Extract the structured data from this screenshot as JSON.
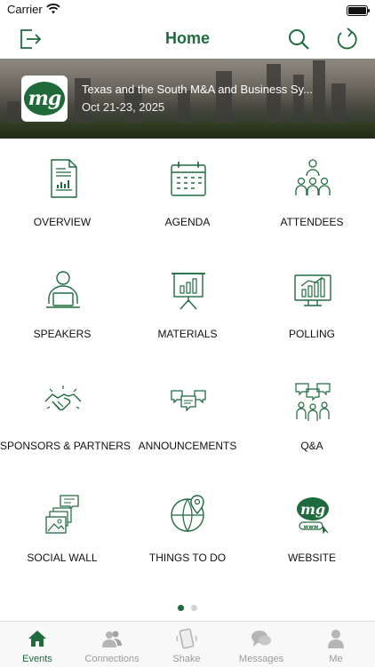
{
  "status_bar": {
    "carrier": "Carrier"
  },
  "nav": {
    "title": "Home",
    "left_icon": "exit-icon",
    "search_icon": "search-icon",
    "refresh_icon": "refresh-icon"
  },
  "event": {
    "title": "Texas and the South M&A and Business Sy...",
    "date": "Oct 21-23, 2025",
    "logo_text": "mg"
  },
  "tiles": [
    {
      "label": "OVERVIEW",
      "icon": "document-chart-icon"
    },
    {
      "label": "AGENDA",
      "icon": "calendar-icon"
    },
    {
      "label": "ATTENDEES",
      "icon": "people-group-icon"
    },
    {
      "label": "SPEAKERS",
      "icon": "speaker-laptop-icon"
    },
    {
      "label": "MATERIALS",
      "icon": "presentation-board-icon"
    },
    {
      "label": "POLLING",
      "icon": "monitor-chart-icon"
    },
    {
      "label": "SPONSORS & PARTNERS",
      "icon": "handshake-icon"
    },
    {
      "label": "ANNOUNCEMENTS",
      "icon": "speech-bubbles-icon"
    },
    {
      "label": "Q&A",
      "icon": "group-discussion-icon"
    },
    {
      "label": "SOCIAL WALL",
      "icon": "photos-chat-icon"
    },
    {
      "label": "THINGS TO DO",
      "icon": "globe-pin-icon"
    },
    {
      "label": "WEBSITE",
      "icon": "website-logo-icon"
    }
  ],
  "pager": {
    "pages": 2,
    "current": 1
  },
  "tabs": [
    {
      "label": "Events",
      "icon": "home-icon",
      "active": true
    },
    {
      "label": "Connections",
      "icon": "connections-icon",
      "active": false
    },
    {
      "label": "Shake",
      "icon": "shake-phone-icon",
      "active": false
    },
    {
      "label": "Messages",
      "icon": "messages-icon",
      "active": false
    },
    {
      "label": "Me",
      "icon": "person-icon",
      "active": false
    }
  ],
  "colors": {
    "accent": "#1e6b3c",
    "inactive": "#9a9a9a"
  }
}
